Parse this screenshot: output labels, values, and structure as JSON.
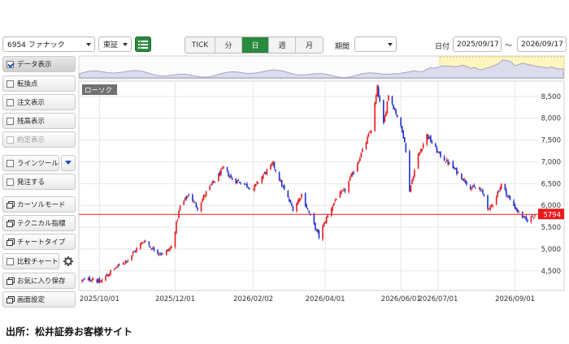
{
  "toolbar": {
    "symbol": "6954 ファナック",
    "market": "東証",
    "intervals": [
      {
        "label": "TICK",
        "active": false
      },
      {
        "label": "分",
        "active": false
      },
      {
        "label": "日",
        "active": true
      },
      {
        "label": "週",
        "active": false
      },
      {
        "label": "月",
        "active": false
      }
    ],
    "period_label": "期間",
    "period_value": "",
    "date_label": "日付",
    "date_from": "2025/09/17",
    "date_sep": "～",
    "date_to": "2026/09/17"
  },
  "side_buttons": [
    {
      "label": "データ表示",
      "icon": "checkbox-icon",
      "checked": true,
      "disabled": false
    },
    {
      "label": "転換点",
      "icon": "checkbox-icon",
      "checked": false,
      "disabled": false
    },
    {
      "label": "注文表示",
      "icon": "checkbox-icon",
      "checked": false,
      "disabled": false
    },
    {
      "label": "残高表示",
      "icon": "checkbox-icon",
      "checked": false,
      "disabled": false
    },
    {
      "label": "約定表示",
      "icon": "checkbox-icon",
      "checked": false,
      "disabled": true
    },
    {
      "label": "ラインツール",
      "icon": "checkbox-icon",
      "checked": false,
      "disabled": false
    },
    {
      "label": "発注する",
      "icon": "checkbox-icon",
      "checked": false,
      "disabled": false
    },
    {
      "label": "カーソルモード",
      "icon": "window-icon",
      "checked": false,
      "disabled": false
    },
    {
      "label": "テクニカル指標",
      "icon": "window-icon",
      "checked": false,
      "disabled": false
    },
    {
      "label": "チャートタイプ",
      "icon": "window-icon",
      "checked": false,
      "disabled": false
    },
    {
      "label": "比較チャート",
      "icon": "checkbox-icon",
      "checked": false,
      "disabled": false
    },
    {
      "label": "お気に入り保存",
      "icon": "window-icon",
      "checked": false,
      "disabled": false
    },
    {
      "label": "画面設定",
      "icon": "window-icon",
      "checked": false,
      "disabled": false
    }
  ],
  "chart_data": {
    "type": "candlestick",
    "series_label": "ローソク",
    "x_tick_labels": [
      "2025/10/01",
      "2025/12/01",
      "2026/02/02",
      "2026/04/01",
      "2026/06/01",
      "2026/07/01",
      "2026/09/01"
    ],
    "y_tick_labels": [
      4500,
      5000,
      5500,
      6000,
      6500,
      7000,
      7500,
      8000,
      8500
    ],
    "ylim": [
      4050,
      8850
    ],
    "last_price_label": "5794",
    "last_price_value": 5794,
    "grid": true,
    "up_color": "#e8191b",
    "down_color": "#1a2fd4",
    "price_line_color": "#e8191b",
    "anchors": [
      [
        "2025-09-17",
        4270
      ],
      [
        "2025-09-26",
        4330
      ],
      [
        "2025-10-01",
        4230
      ],
      [
        "2025-10-10",
        4480
      ],
      [
        "2025-10-24",
        4770
      ],
      [
        "2025-11-06",
        5200
      ],
      [
        "2025-11-13",
        5000
      ],
      [
        "2025-11-21",
        4880
      ],
      [
        "2025-11-28",
        5040
      ],
      [
        "2025-12-05",
        5980
      ],
      [
        "2025-12-12",
        6250
      ],
      [
        "2025-12-19",
        5950
      ],
      [
        "2025-12-26",
        6300
      ],
      [
        "2026-01-09",
        6850
      ],
      [
        "2026-01-16",
        6600
      ],
      [
        "2026-01-23",
        6530
      ],
      [
        "2026-02-02",
        6380
      ],
      [
        "2026-02-10",
        6700
      ],
      [
        "2026-02-18",
        6950
      ],
      [
        "2026-02-26",
        6400
      ],
      [
        "2026-03-06",
        5920
      ],
      [
        "2026-03-13",
        6250
      ],
      [
        "2026-03-20",
        5750
      ],
      [
        "2026-03-27",
        5280
      ],
      [
        "2026-04-01",
        5650
      ],
      [
        "2026-04-10",
        6180
      ],
      [
        "2026-04-17",
        6350
      ],
      [
        "2026-04-24",
        6800
      ],
      [
        "2026-05-01",
        7250
      ],
      [
        "2026-05-08",
        7750
      ],
      [
        "2026-05-13",
        8700
      ],
      [
        "2026-05-18",
        7850
      ],
      [
        "2026-05-22",
        8550
      ],
      [
        "2026-05-29",
        8050
      ],
      [
        "2026-06-04",
        7500
      ],
      [
        "2026-06-08",
        6350
      ],
      [
        "2026-06-15",
        7150
      ],
      [
        "2026-06-22",
        7620
      ],
      [
        "2026-07-01",
        7200
      ],
      [
        "2026-07-10",
        6950
      ],
      [
        "2026-07-20",
        6650
      ],
      [
        "2026-07-28",
        6400
      ],
      [
        "2026-08-03",
        6380
      ],
      [
        "2026-08-07",
        6230
      ],
      [
        "2026-08-11",
        5880
      ],
      [
        "2026-08-21",
        6480
      ],
      [
        "2026-08-28",
        6120
      ],
      [
        "2026-09-03",
        5870
      ],
      [
        "2026-09-10",
        5650
      ],
      [
        "2026-09-17",
        5794
      ]
    ]
  },
  "navigator": {
    "selection": "2026/09/17"
  },
  "footer": {
    "source": "出所：松井証券お客様サイト"
  }
}
